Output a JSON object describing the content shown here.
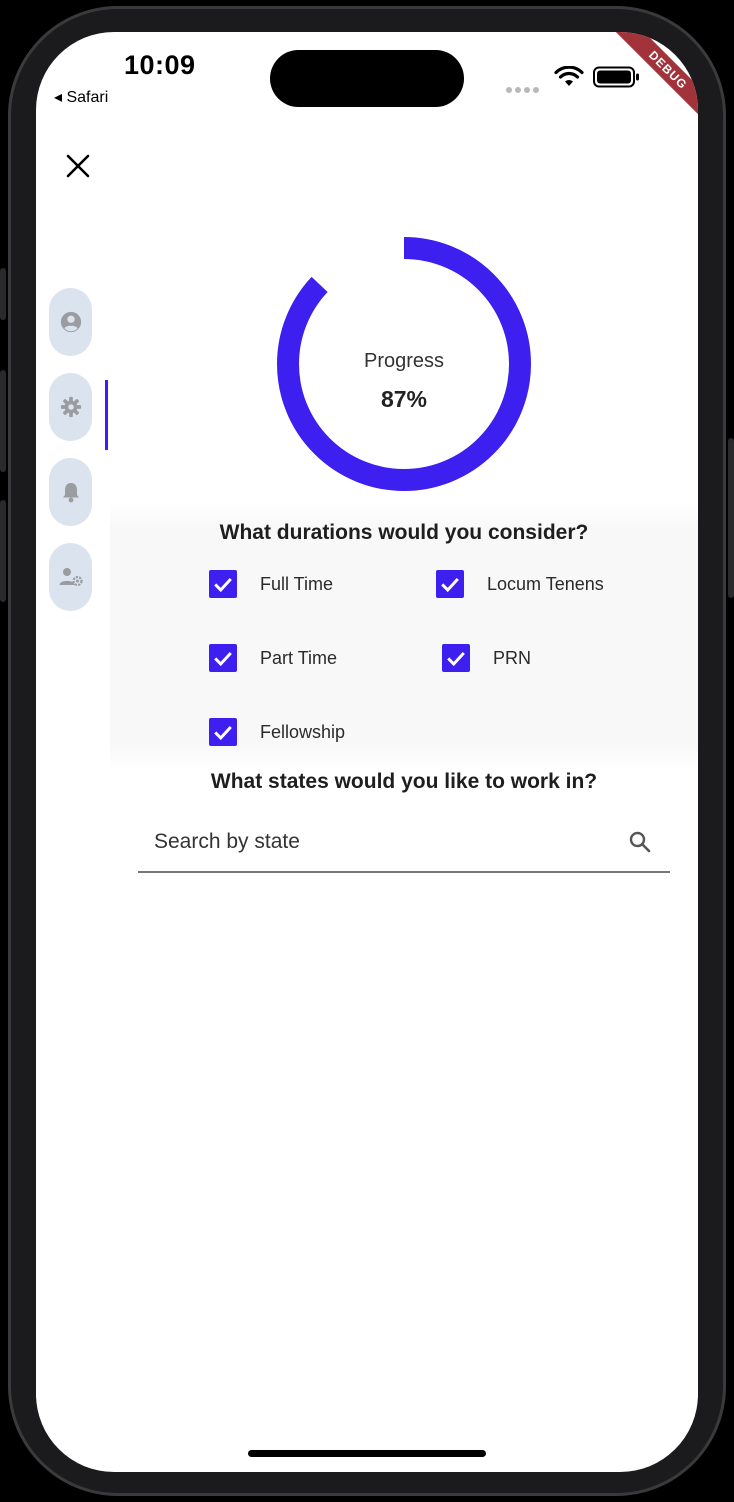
{
  "status_bar": {
    "time": "10:09",
    "back_label": "◂ Safari",
    "debug_label": "DEBUG"
  },
  "progress": {
    "label": "Progress",
    "value_text": "87%",
    "fraction": 0.87,
    "color": "#3d1ff0"
  },
  "nav_rail": {
    "items": [
      {
        "icon": "account-circle-icon",
        "selected": false
      },
      {
        "icon": "gear-icon",
        "selected": true
      },
      {
        "icon": "bell-icon",
        "selected": false
      },
      {
        "icon": "user-settings-icon",
        "selected": false
      }
    ]
  },
  "durations": {
    "heading": "What durations would you consider?",
    "options": [
      {
        "label": "Full Time",
        "checked": true
      },
      {
        "label": "Locum Tenens",
        "checked": true
      },
      {
        "label": "Part Time",
        "checked": true
      },
      {
        "label": "PRN",
        "checked": true
      },
      {
        "label": "Fellowship",
        "checked": true
      }
    ]
  },
  "states": {
    "heading": "What states would you like to work in?",
    "search_placeholder": "Search by state"
  },
  "colors": {
    "accent": "#3d1ff0",
    "rail_bg": "#dbe3ef",
    "rail_icon": "#9a9ca0"
  }
}
